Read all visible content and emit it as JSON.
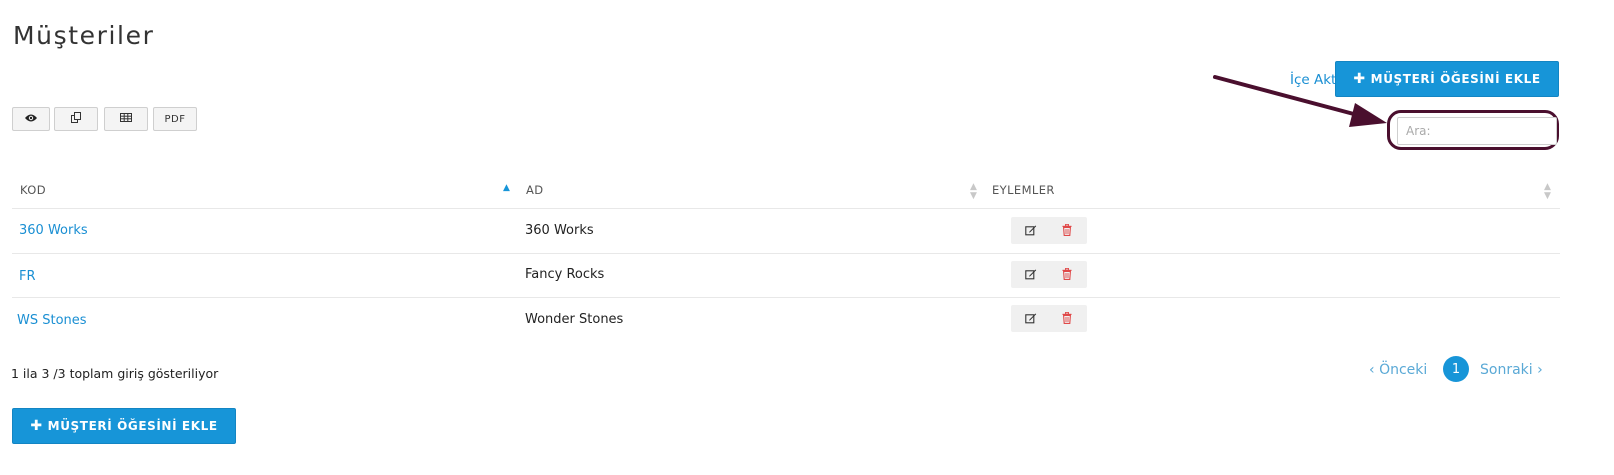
{
  "page": {
    "title": "Müşteriler"
  },
  "header": {
    "import_label": "İçe Aktar",
    "add_label": "MÜŞTERİ ÖĞESİNİ EKLE"
  },
  "toolbar": {
    "view_icon": "eye-icon",
    "copy_icon": "copy-icon",
    "excel_icon": "table-icon",
    "pdf_label": "PDF"
  },
  "search": {
    "placeholder": "Ara:",
    "value": ""
  },
  "table": {
    "columns": [
      "KOD",
      "AD",
      "EYLEMLER"
    ],
    "rows": [
      {
        "code": "360 Works",
        "name": "360 Works"
      },
      {
        "code": "FR",
        "name": "Fancy Rocks"
      },
      {
        "code": "WS Stones",
        "name": "Wonder Stones"
      }
    ]
  },
  "footer": {
    "info": "1 ila 3 /3 toplam giriş gösteriliyor",
    "prev_label": "Önceki",
    "next_label": "Sonraki",
    "current_page": "1",
    "add_label": "MÜŞTERİ ÖĞESİNİ EKLE"
  },
  "colors": {
    "accent": "#1795d8",
    "link": "#1a8fd3",
    "annotation": "#4a0f2e",
    "delete": "#e04848"
  }
}
